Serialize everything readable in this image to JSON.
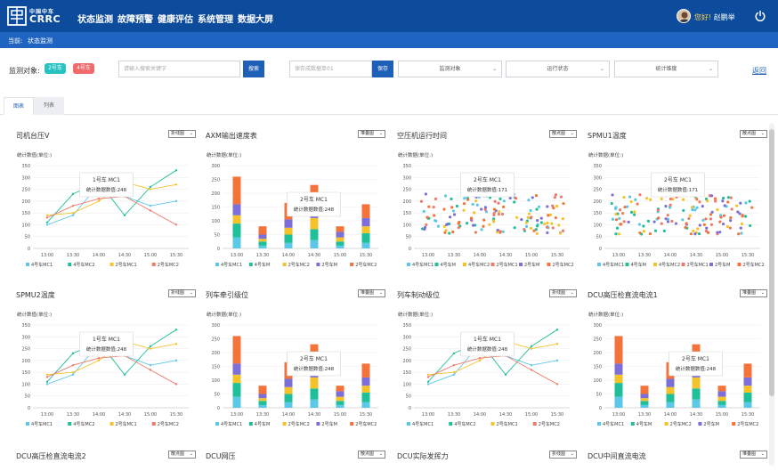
{
  "header": {
    "brand_zh": "中国中车",
    "brand_en": "CRRC",
    "menu": [
      "状态监测",
      "故障预警",
      "健康评估",
      "系统管理",
      "数据大屏"
    ],
    "greeting_prefix": "您好!",
    "user_name": "赵鹏举"
  },
  "breadcrumb": {
    "prefix": "当前:",
    "current": "状态监测"
  },
  "filter": {
    "label": "监测对象:",
    "tags": [
      {
        "label": "2号车",
        "color": "#27c3c3"
      },
      {
        "label": "4号车",
        "color": "#f06a6a"
      }
    ],
    "search_placeholder": "请输入搜索关键字",
    "search_button": "搜索",
    "save_placeholder": "保存成数据单01",
    "save_button": "保存",
    "selects": [
      "监测对象",
      "运行状态",
      "统计维度"
    ],
    "back_link": "返回"
  },
  "tabs": [
    {
      "label": "图表",
      "active": true
    },
    {
      "label": "列表",
      "active": false
    }
  ],
  "colors": {
    "cyan": "#5bc8e8",
    "teal": "#1fbf9a",
    "yellow": "#f5c22a",
    "red": "#f07a6a",
    "purple": "#7c6fd8",
    "orange": "#f4733a",
    "nav": "#0d4c9c",
    "crumb": "#1e64c0"
  },
  "panels": [
    {
      "title": "司机台压V",
      "dropdown": "折线图",
      "unit": "统计数值(单位:)",
      "tooltip": {
        "title": "1号车 MC1",
        "label": "统计数据数值:",
        "value": "248"
      },
      "chart_data": {
        "type": "line",
        "x": [
          "13:00",
          "13:30",
          "14:00",
          "14:30",
          "15:00",
          "15:30"
        ],
        "ylim": [
          0,
          350
        ],
        "yticks": [
          0,
          50,
          100,
          150,
          200,
          250,
          300,
          350
        ],
        "series": [
          {
            "name": "4号车MC1",
            "color": "#5bc8e8",
            "values": [
              100,
              140,
              270,
              220,
              180,
              200
            ]
          },
          {
            "name": "4号车MC2",
            "color": "#1fbf9a",
            "values": [
              110,
              230,
              280,
              140,
              260,
              330
            ]
          },
          {
            "name": "2号车MC1",
            "color": "#f5c22a",
            "values": [
              140,
              150,
              200,
              280,
              250,
              270
            ]
          },
          {
            "name": "2号车MC2",
            "color": "#f07a6a",
            "values": [
              130,
              180,
              210,
              220,
              160,
              100
            ]
          }
        ]
      }
    },
    {
      "title": "AXM输出速度表",
      "dropdown": "堆叠图",
      "unit": "统计数据(单位:)",
      "tooltip": {
        "title": "2号车 MC1",
        "label": "统计数据数值:",
        "value": "248"
      },
      "chart_data": {
        "type": "bar",
        "categories": [
          "13:00",
          "13:30",
          "14:00",
          "14:30",
          "15:00",
          "15:30"
        ],
        "ylim": [
          0,
          300
        ],
        "yticks": [
          0,
          50,
          100,
          150,
          200,
          250,
          300
        ],
        "series": [
          {
            "name": "4号车MC1",
            "color": "#5bc8e8",
            "values": [
              40,
              10,
              20,
              30,
              10,
              20
            ]
          },
          {
            "name": "4号车M",
            "color": "#1fbf9a",
            "values": [
              50,
              15,
              30,
              40,
              15,
              35
            ]
          },
          {
            "name": "2号车MC2",
            "color": "#f5c22a",
            "values": [
              30,
              10,
              25,
              40,
              15,
              25
            ]
          },
          {
            "name": "2号车M",
            "color": "#7c6fd8",
            "values": [
              40,
              15,
              30,
              40,
              20,
              30
            ]
          },
          {
            "name": "2号车MC2",
            "color": "#f4733a",
            "values": [
              100,
              30,
              60,
              80,
              20,
              50
            ]
          }
        ]
      }
    },
    {
      "title": "空压机运行时间",
      "dropdown": "散点图",
      "unit": "统计数据(单位:)",
      "tooltip": {
        "title": "2号车 MC1",
        "label": "统计数据数值:",
        "value": "171"
      },
      "chart_data": {
        "type": "scatter",
        "x": [
          "13:00",
          "13:30",
          "14:00",
          "14:30",
          "15:00",
          "15:30"
        ],
        "ylim": [
          0,
          350
        ],
        "yticks": [
          0,
          50,
          100,
          150,
          200,
          250,
          300,
          350
        ],
        "series": [
          {
            "name": "4号车MC1",
            "color": "#5bc8e8"
          },
          {
            "name": "4号车M",
            "color": "#1fbf9a"
          },
          {
            "name": "4号车MC2",
            "color": "#f5c22a"
          },
          {
            "name": "2号车MC1",
            "color": "#f07a6a"
          },
          {
            "name": "2号车M",
            "color": "#7c6fd8"
          },
          {
            "name": "2号车MC2",
            "color": "#f4733a"
          }
        ]
      }
    },
    {
      "title": "SPMU1温度",
      "dropdown": "散点图",
      "unit": "统计数据(单位:)",
      "tooltip": {
        "title": "2号车 MC1",
        "label": "统计数据数值:",
        "value": "171"
      },
      "chart_data": {
        "type": "scatter",
        "x": [
          "13:00",
          "13:30",
          "14:00",
          "14:30",
          "15:00",
          "15:30"
        ],
        "ylim": [
          0,
          350
        ],
        "yticks": [
          0,
          50,
          100,
          150,
          200,
          250,
          300,
          350
        ],
        "series": [
          {
            "name": "4号车MC1",
            "color": "#5bc8e8"
          },
          {
            "name": "4号车M",
            "color": "#1fbf9a"
          },
          {
            "name": "4号车MC2",
            "color": "#f5c22a"
          },
          {
            "name": "2号车MC1",
            "color": "#f07a6a"
          },
          {
            "name": "2号车M",
            "color": "#7c6fd8"
          },
          {
            "name": "2号车MC2",
            "color": "#f4733a"
          }
        ]
      }
    },
    {
      "title": "SPMU2温度",
      "dropdown": "折线图",
      "unit": "统计数值(单位:)",
      "tooltip": {
        "title": "1号车 MC1",
        "label": "统计数据数值:",
        "value": "248"
      },
      "chart_data": {
        "type": "line",
        "x": [
          "13:00",
          "13:30",
          "14:00",
          "14:30",
          "15:00",
          "15:30"
        ],
        "ylim": [
          0,
          350
        ],
        "yticks": [
          0,
          50,
          100,
          150,
          200,
          250,
          300,
          350
        ],
        "series": [
          {
            "name": "4号车MC1",
            "color": "#5bc8e8",
            "values": [
              100,
              140,
              270,
              220,
              180,
              200
            ]
          },
          {
            "name": "4号车MC2",
            "color": "#1fbf9a",
            "values": [
              110,
              230,
              280,
              140,
              260,
              330
            ]
          },
          {
            "name": "2号车MC1",
            "color": "#f5c22a",
            "values": [
              140,
              150,
              200,
              280,
              250,
              270
            ]
          },
          {
            "name": "2号车MC2",
            "color": "#f07a6a",
            "values": [
              130,
              180,
              210,
              220,
              160,
              100
            ]
          }
        ]
      }
    },
    {
      "title": "列车牵引级位",
      "dropdown": "堆叠图",
      "unit": "统计数据(单位:)",
      "tooltip": {
        "title": "2号车 MC1",
        "label": "统计数据数值:",
        "value": "248"
      },
      "chart_data": {
        "type": "bar",
        "categories": [
          "13:00",
          "13:30",
          "14:00",
          "14:30",
          "15:00",
          "15:30"
        ],
        "ylim": [
          0,
          300
        ],
        "yticks": [
          0,
          50,
          100,
          150,
          200,
          250,
          300
        ],
        "series": [
          {
            "name": "4号车MC1",
            "color": "#5bc8e8",
            "values": [
              40,
              10,
              20,
              30,
              10,
              20
            ]
          },
          {
            "name": "4号车M",
            "color": "#1fbf9a",
            "values": [
              50,
              15,
              30,
              40,
              15,
              35
            ]
          },
          {
            "name": "2号车MC2",
            "color": "#f5c22a",
            "values": [
              30,
              10,
              25,
              40,
              15,
              25
            ]
          },
          {
            "name": "2号车M",
            "color": "#7c6fd8",
            "values": [
              40,
              15,
              30,
              40,
              20,
              30
            ]
          },
          {
            "name": "2号车MC2",
            "color": "#f4733a",
            "values": [
              100,
              30,
              60,
              80,
              20,
              50
            ]
          }
        ]
      }
    },
    {
      "title": "列车制动级位",
      "dropdown": "折线图",
      "unit": "统计数据(单位:)",
      "tooltip": {
        "title": "1号车 MC1",
        "label": "统计数据数值:",
        "value": "248"
      },
      "chart_data": {
        "type": "line",
        "x": [
          "13:00",
          "13:30",
          "14:00",
          "14:30",
          "15:00",
          "15:30"
        ],
        "ylim": [
          0,
          350
        ],
        "yticks": [
          0,
          50,
          100,
          150,
          200,
          250,
          300,
          350
        ],
        "series": [
          {
            "name": "4号车MC1",
            "color": "#5bc8e8",
            "values": [
              100,
              140,
              270,
              220,
              180,
              200
            ]
          },
          {
            "name": "4号车MC2",
            "color": "#1fbf9a",
            "values": [
              110,
              230,
              280,
              140,
              260,
              330
            ]
          },
          {
            "name": "2号车MC1",
            "color": "#f5c22a",
            "values": [
              140,
              150,
              200,
              280,
              250,
              270
            ]
          },
          {
            "name": "2号车MC2",
            "color": "#f07a6a",
            "values": [
              130,
              180,
              210,
              220,
              160,
              100
            ]
          }
        ]
      }
    },
    {
      "title": "DCU高压检直流电流1",
      "dropdown": "堆叠图",
      "unit": "统计数据(单位:)",
      "tooltip": {
        "title": "2号车 MC1",
        "label": "统计数据数值:",
        "value": "248"
      },
      "chart_data": {
        "type": "bar",
        "categories": [
          "13:00",
          "13:30",
          "14:00",
          "14:30",
          "15:00",
          "15:30"
        ],
        "ylim": [
          0,
          300
        ],
        "yticks": [
          0,
          50,
          100,
          150,
          200,
          250,
          300
        ],
        "series": [
          {
            "name": "4号车MC1",
            "color": "#5bc8e8",
            "values": [
              40,
              10,
              20,
              30,
              10,
              20
            ]
          },
          {
            "name": "4号车M",
            "color": "#1fbf9a",
            "values": [
              50,
              15,
              30,
              40,
              15,
              35
            ]
          },
          {
            "name": "2号车MC2",
            "color": "#f5c22a",
            "values": [
              30,
              10,
              25,
              40,
              15,
              25
            ]
          },
          {
            "name": "2号车M",
            "color": "#7c6fd8",
            "values": [
              40,
              15,
              30,
              40,
              20,
              30
            ]
          },
          {
            "name": "2号车MC2",
            "color": "#f4733a",
            "values": [
              100,
              30,
              60,
              80,
              20,
              50
            ]
          }
        ]
      }
    }
  ],
  "bottom_panels": [
    {
      "title": "DCU高压检直流电流2",
      "dropdown": "散点图"
    },
    {
      "title": "DCU网压",
      "dropdown": "散点图"
    },
    {
      "title": "DCU实际发挥力",
      "dropdown": "折线图"
    },
    {
      "title": "DCU中间直流电流",
      "dropdown": "堆叠图"
    }
  ]
}
